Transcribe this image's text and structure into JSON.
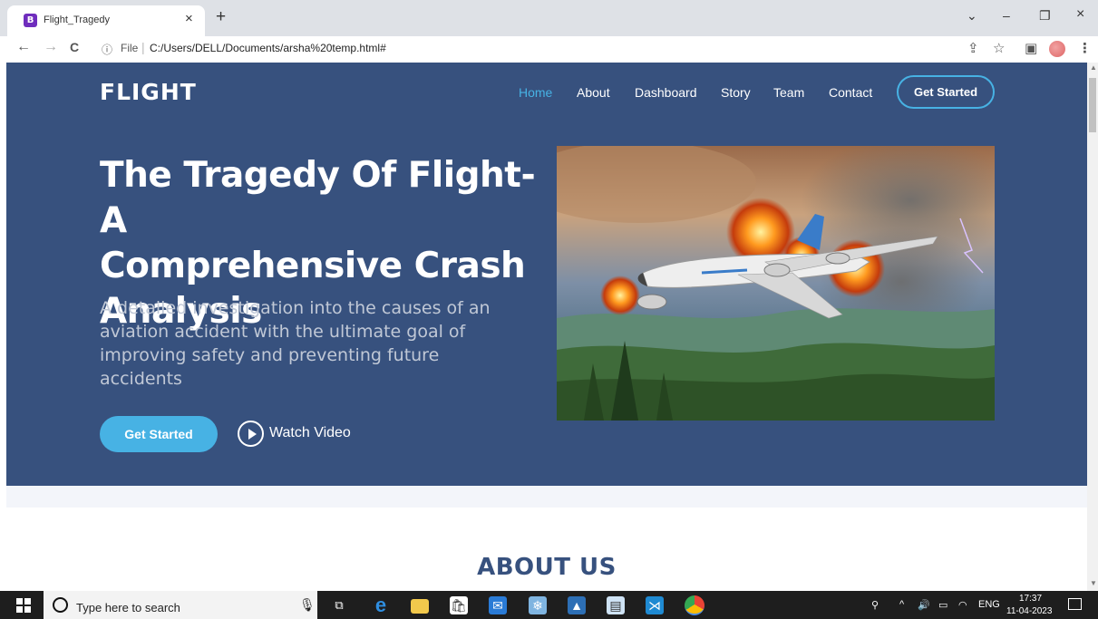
{
  "browser": {
    "tab": {
      "favicon": "B",
      "title": "Flight_Tragedy",
      "close": "×"
    },
    "new_tab": "+",
    "window_controls": {
      "tab_search": "⌄",
      "minimize": "–",
      "restore": "❐",
      "close": "×"
    },
    "nav": {
      "back": "←",
      "forward": "→",
      "reload": "C"
    },
    "url": {
      "info": "ⓘ",
      "scheme": "File",
      "path": "C:/Users/DELL/Documents/arsha%20temp.html#"
    },
    "toolbar": {
      "share": "⇪",
      "bookmark": "☆",
      "sidebar": "▣",
      "menu": "⋮"
    }
  },
  "header": {
    "logo": "FLIGHT",
    "nav": [
      {
        "label": "Home",
        "active": true
      },
      {
        "label": "About"
      },
      {
        "label": "Dashboard"
      },
      {
        "label": "Story"
      },
      {
        "label": "Team"
      },
      {
        "label": "Contact"
      }
    ],
    "cta": "Get Started"
  },
  "hero": {
    "title_lines": [
      "The Tragedy Of Flight-A",
      "Comprehensive Crash",
      "Analysis"
    ],
    "subtitle_lines": [
      "A detailed investigation into the causes of an",
      "aviation accident with the ultimate goal of",
      "improving safety and preventing future accidents"
    ],
    "primary_button": "Get Started",
    "video_link": "Watch Video",
    "image_icon": "burning-airplane-image"
  },
  "about": {
    "title": "ABOUT US"
  },
  "taskbar": {
    "search_placeholder": "Type here to search",
    "apps": [
      "task-view",
      "edge",
      "file-explorer",
      "store",
      "mail",
      "snipping",
      "photos",
      "notepad",
      "vscode",
      "chrome"
    ],
    "tray": {
      "language": "ENG",
      "time": "17:37",
      "date": "11-04-2023"
    }
  },
  "colors": {
    "hero_bg": "#37517e",
    "accent": "#47b2e4",
    "taskbar": "#1e1e1e"
  }
}
